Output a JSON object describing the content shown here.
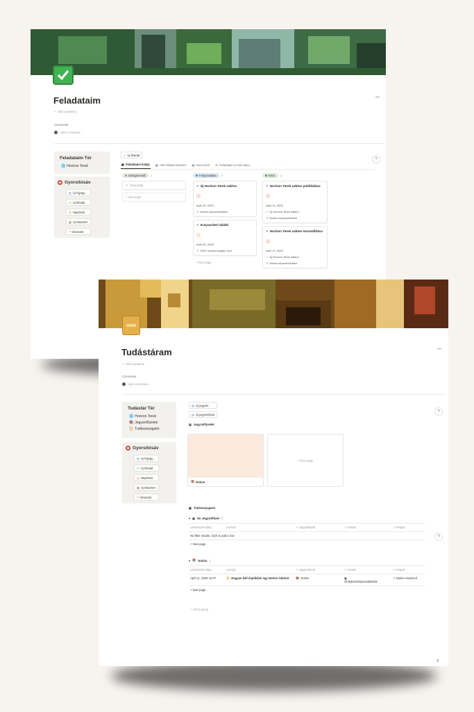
{
  "page1": {
    "title": "Feladataim",
    "add_property": "Add a property",
    "comments_label": "Comments",
    "add_comment": "Add a comment...",
    "side": {
      "title": "Feladataim Tér",
      "link": "Horizon Terek"
    },
    "quick": {
      "title": "Gyorsítósáv",
      "items": [
        "Új fejjegy...",
        "Új feladat",
        "Naplózás",
        "Új listaelem",
        "Útmutató"
      ]
    },
    "new_task_button": "Új feladat",
    "tabs": [
      "Feladataim listája",
      "Heti feladat ütemterv",
      "Havi nézet",
      "Feladataim a mai napra"
    ],
    "columns": [
      {
        "status": "Elvégezendő",
        "count": "1",
        "color": "#e9e8e5",
        "dot": "#9b9892",
        "cards": [],
        "new_page": "New page"
      },
      {
        "status": "Folyamatban",
        "count": "2",
        "color": "#d9e8f5",
        "dot": "#4b8ad6",
        "cards": [
          {
            "title": "Új Horizon Terek sablon",
            "prio": "!",
            "date": "April 30, 2025",
            "rel": "Notion népszerűsítése"
          },
          {
            "title": "Kutyasziteri tálalkí",
            "prio": "!",
            "date": "April 30, 2025",
            "rel": "2009 Tavaszi Angliai Túra"
          }
        ],
        "new_page": "New page"
      },
      {
        "status": "Kész",
        "count": "2",
        "color": "#ddeddc",
        "dot": "#4b9a5a",
        "cards": [
          {
            "title": "Horizon Terek sablon publikálása",
            "prio": "!",
            "date": "April 15, 2025",
            "rel": "Új Horizon Terek sablon",
            "rel2": "Notion népszerűsítése"
          },
          {
            "title": "Horizon Terek sablon összeállítása",
            "prio": "!",
            "date": "April 15, 2025",
            "rel": "Új Horizon Terek sablon",
            "rel2": "Notion népszerűsítése"
          }
        ]
      }
    ],
    "dash": "—",
    "help": "?"
  },
  "page2": {
    "title": "Tudástáram",
    "add_property": "Add a property",
    "comments_label": "Comments",
    "add_comment": "Add a comment...",
    "side": {
      "title": "Tudástár Tér",
      "links": [
        "Horizon Terek",
        "Jegyzetfüzetek",
        "Tudásanyagaim"
      ]
    },
    "quick": {
      "title": "Gyorsítósáv",
      "items": [
        "Új fejjegy...",
        "Új feladat",
        "Naplózás",
        "Új listaelem",
        "Útmutató"
      ]
    },
    "buttons": [
      "Új jegyzet",
      "Új jegyzetfüzet"
    ],
    "gallery_title": "Jegyzetfüzetek",
    "gallery_card": "Notion",
    "gallery_new": "New page",
    "table_title": "Tudásanyagaim",
    "group1": {
      "label": "No Jegyzetfüzet",
      "count": "0",
      "empty": "No filter results. Click to add a row"
    },
    "group2": {
      "label": "Notion",
      "count": "1"
    },
    "headers": [
      "Létrehozás dátu...",
      "Név",
      "Jegyzetfüzet",
      "Terület",
      "Projekt"
    ],
    "row": {
      "date": "April 11, 2025 10:07",
      "name": "Hogyan kell duplikálni egy Notion sablont",
      "notebook": "Notion",
      "area": "Önfejlesztés/produktivitás",
      "project": "Notion népszerű"
    },
    "new_page": "New page",
    "add_group": "Add a group",
    "dash": "—",
    "help": "?"
  }
}
